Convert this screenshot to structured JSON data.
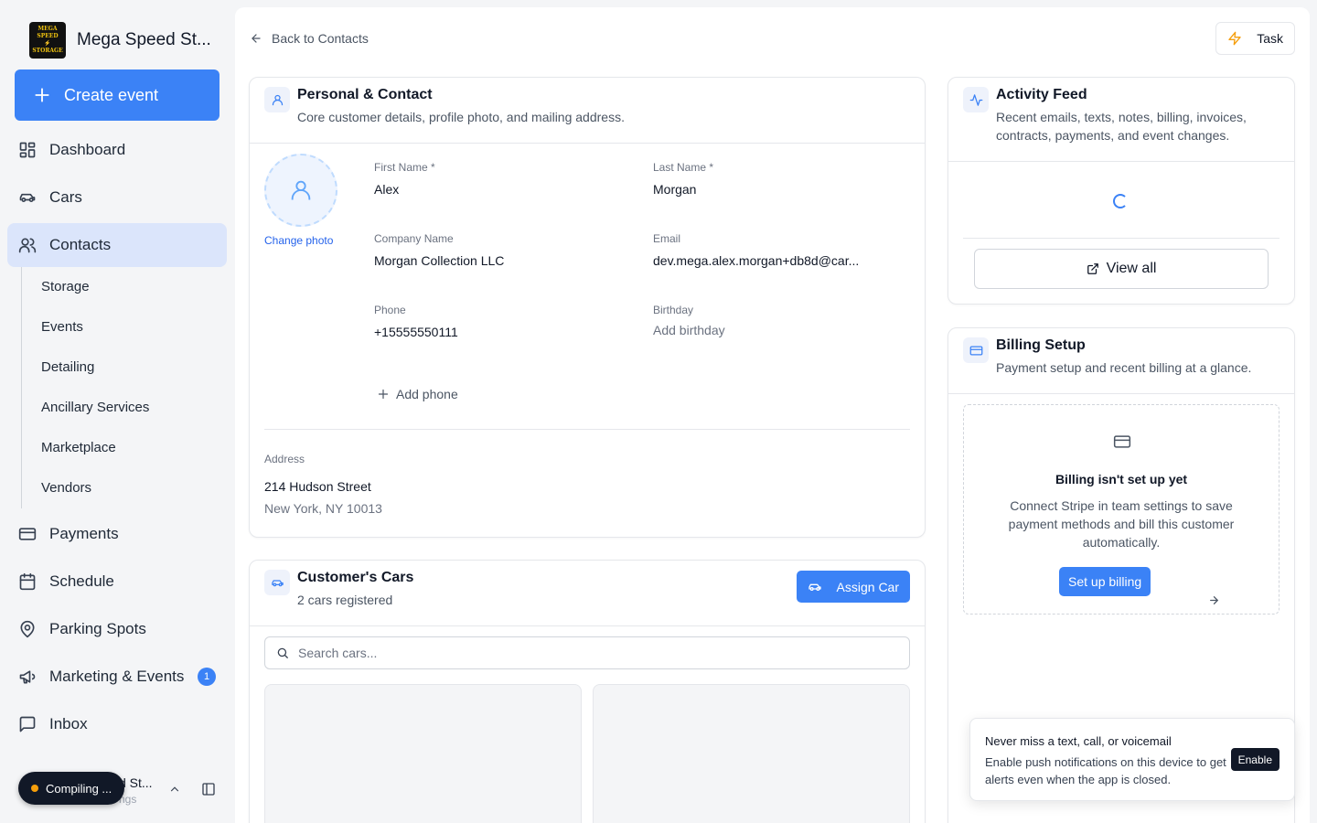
{
  "sidebar": {
    "brand": {
      "name": "Mega Speed St...",
      "logo_text": [
        "MEGA SPEED",
        "STORAGE"
      ]
    },
    "create_label": "Create event",
    "nav": [
      {
        "label": "Dashboard",
        "icon": "dashboard-icon"
      },
      {
        "label": "Cars",
        "icon": "car-icon"
      },
      {
        "label": "Contacts",
        "icon": "users-icon",
        "active": true
      }
    ],
    "subnav": [
      "Storage",
      "Events",
      "Detailing",
      "Ancillary Services",
      "Marketplace",
      "Vendors"
    ],
    "nav2": [
      {
        "label": "Payments",
        "icon": "credit-card-icon"
      },
      {
        "label": "Schedule",
        "icon": "calendar-icon"
      },
      {
        "label": "Parking Spots",
        "icon": "map-pin-icon"
      },
      {
        "label": "Marketing & Events",
        "icon": "megaphone-icon",
        "badge": "1"
      },
      {
        "label": "Inbox",
        "icon": "message-square-icon"
      }
    ],
    "footer": {
      "team": "d St...",
      "sub": "ngs"
    },
    "compiling": "Compiling ..."
  },
  "header": {
    "back_label": "Back to Contacts",
    "task_label": "Task"
  },
  "personal": {
    "title": "Personal & Contact",
    "subtitle": "Core customer details, profile photo, and mailing address.",
    "change_photo": "Change photo",
    "fields": {
      "first_name": {
        "label": "First Name *",
        "value": "Alex"
      },
      "last_name": {
        "label": "Last Name *",
        "value": "Morgan"
      },
      "company": {
        "label": "Company Name",
        "value": "Morgan Collection LLC"
      },
      "email": {
        "label": "Email",
        "value": "dev.mega.alex.morgan+db8d@car..."
      },
      "phone": {
        "label": "Phone",
        "value": "+15555550111"
      },
      "birthday": {
        "label": "Birthday",
        "value": "Add birthday"
      }
    },
    "add_phone": "Add phone",
    "address": {
      "label": "Address",
      "line1": "214 Hudson Street",
      "line2": "New York, NY 10013"
    }
  },
  "cars": {
    "title": "Customer's Cars",
    "subtitle": "2 cars registered",
    "assign_label": "Assign Car",
    "search_placeholder": "Search cars..."
  },
  "activity": {
    "title": "Activity Feed",
    "subtitle": "Recent emails, texts, notes, billing, invoices, contracts, payments, and event changes.",
    "view_all": "View all"
  },
  "billing": {
    "title": "Billing Setup",
    "subtitle": "Payment setup and recent billing at a glance.",
    "empty_title": "Billing isn't set up yet",
    "empty_text": "Connect Stripe in team settings to save payment methods and bill this customer automatically.",
    "setup_label": "Set up billing"
  },
  "toast": {
    "title": "Never miss a text, call, or voicemail",
    "text": "Enable push notifications on this device to get alerts even when the app is closed.",
    "enable_label": "Enable"
  },
  "colors": {
    "accent": "#3b82f6",
    "active_nav": "#dbe5fb",
    "warning": "#f59e0b"
  }
}
